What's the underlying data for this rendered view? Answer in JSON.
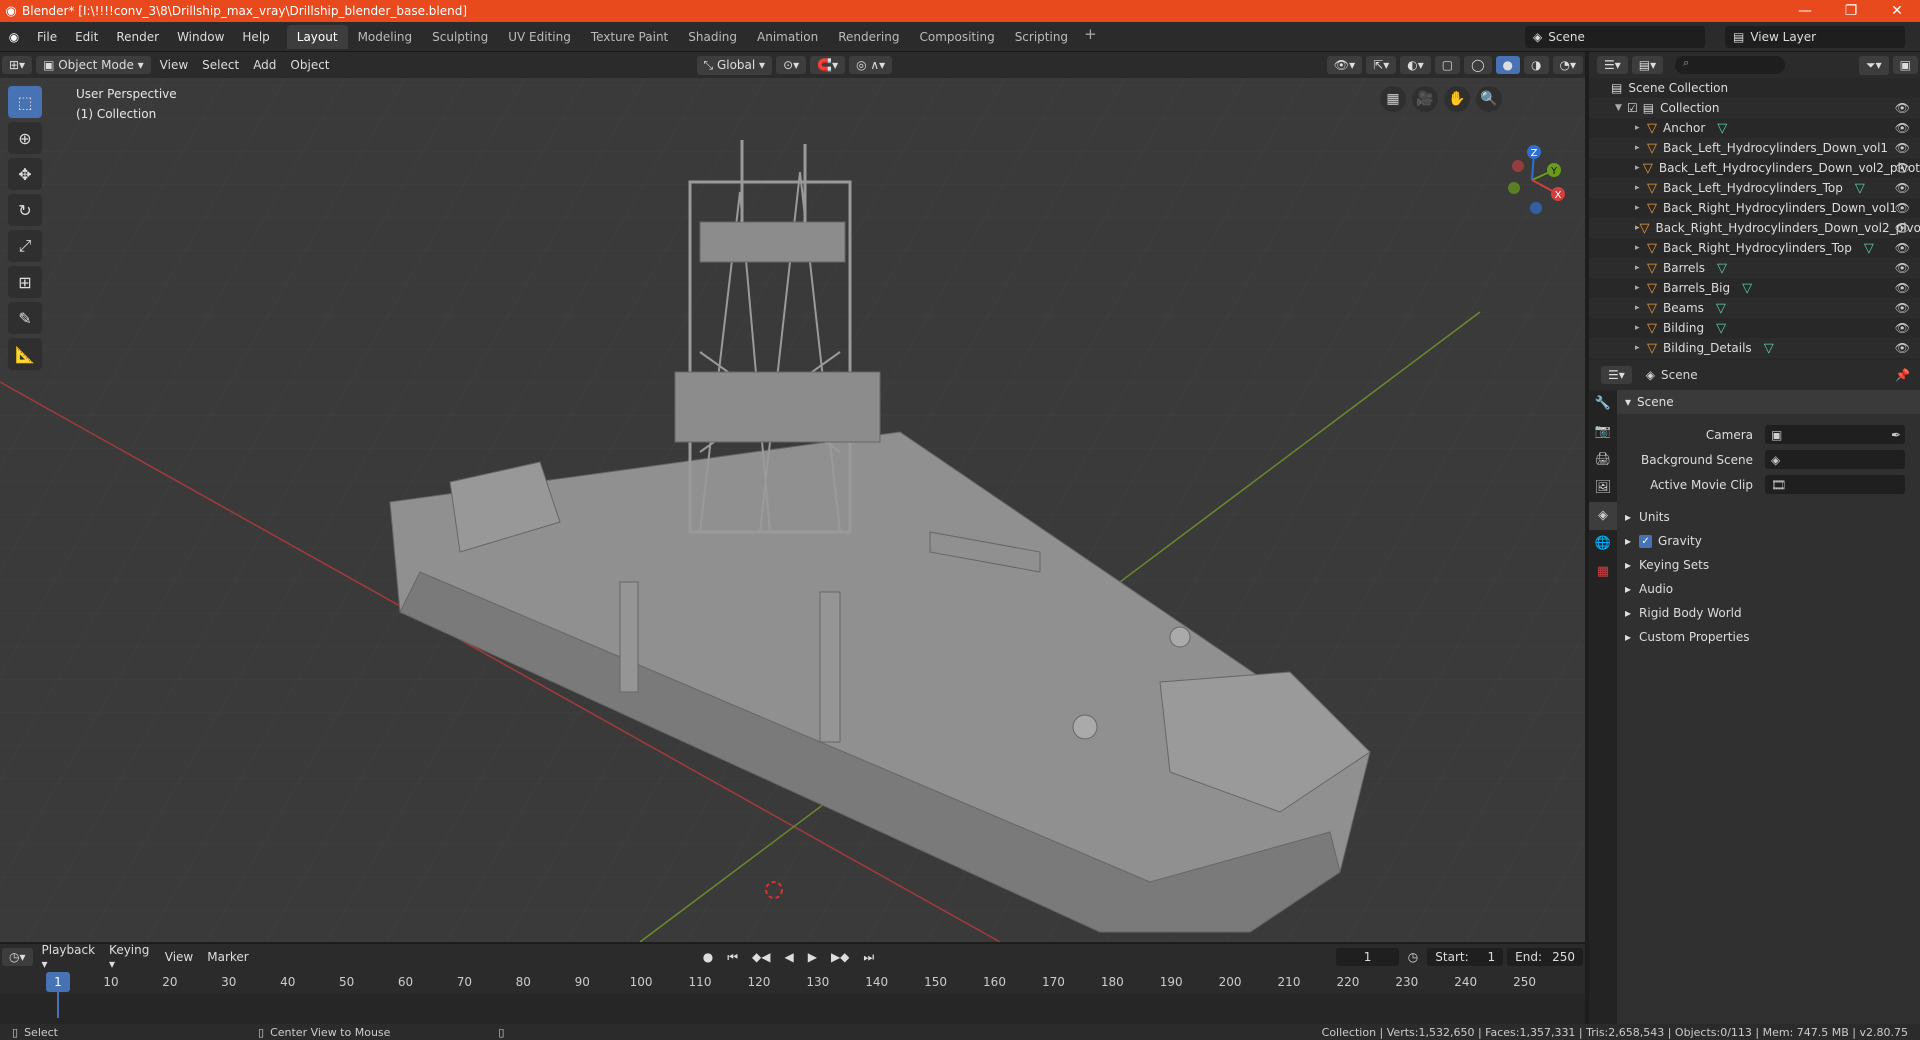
{
  "window": {
    "title": "Blender* [I:\\!!!!conv_3\\8\\Drillship_max_vray\\Drillship_blender_base.blend]",
    "controls": [
      "—",
      "❐",
      "✕"
    ]
  },
  "menu": [
    "File",
    "Edit",
    "Render",
    "Window",
    "Help"
  ],
  "workspaces": [
    "Layout",
    "Modeling",
    "Sculpting",
    "UV Editing",
    "Texture Paint",
    "Shading",
    "Animation",
    "Rendering",
    "Compositing",
    "Scripting"
  ],
  "active_workspace": "Layout",
  "scene_selector": "Scene",
  "view_layer": "View Layer",
  "viewport": {
    "mode": "Object Mode",
    "menus": [
      "View",
      "Select",
      "Add",
      "Object"
    ],
    "transform_orientation": "Global",
    "info_line1": "User Perspective",
    "info_line2": "(1) Collection",
    "gizmo_axes": {
      "z": "Z",
      "y": "Y",
      "x": "X"
    }
  },
  "outliner": {
    "root": "Scene Collection",
    "collection": "Collection",
    "items": [
      {
        "name": "Anchor",
        "mesh": true
      },
      {
        "name": "Back_Left_Hydrocylinders_Down_vol1",
        "mesh": false
      },
      {
        "name": "Back_Left_Hydrocylinders_Down_vol2_pivot",
        "mesh": false
      },
      {
        "name": "Back_Left_Hydrocylinders_Top",
        "mesh": true
      },
      {
        "name": "Back_Right_Hydrocylinders_Down_vol1",
        "mesh": false
      },
      {
        "name": "Back_Right_Hydrocylinders_Down_vol2_pivo",
        "mesh": false
      },
      {
        "name": "Back_Right_Hydrocylinders_Top",
        "mesh": true
      },
      {
        "name": "Barrels",
        "mesh": true
      },
      {
        "name": "Barrels_Big",
        "mesh": true
      },
      {
        "name": "Beams",
        "mesh": true
      },
      {
        "name": "Bilding",
        "mesh": true
      },
      {
        "name": "Bilding_Details",
        "mesh": true
      }
    ]
  },
  "properties": {
    "context": "Scene",
    "panel": "Scene",
    "fields": [
      {
        "label": "Camera",
        "value": ""
      },
      {
        "label": "Background Scene",
        "value": ""
      },
      {
        "label": "Active Movie Clip",
        "value": ""
      }
    ],
    "subpanels": [
      "Units",
      "Gravity",
      "Keying Sets",
      "Audio",
      "Rigid Body World",
      "Custom Properties"
    ],
    "gravity_checked": true
  },
  "timeline": {
    "menus": [
      "Playback",
      "Keying",
      "View",
      "Marker"
    ],
    "current_frame": "1",
    "start_label": "Start:",
    "start": "1",
    "end_label": "End:",
    "end": "250",
    "ticks": [
      "10",
      "20",
      "30",
      "40",
      "50",
      "60",
      "70",
      "80",
      "90",
      "100",
      "110",
      "120",
      "130",
      "140",
      "150",
      "160",
      "170",
      "180",
      "190",
      "200",
      "210",
      "220",
      "230",
      "240",
      "250"
    ]
  },
  "status": {
    "left1": "Select",
    "left2": "Center View to Mouse",
    "right": "Collection | Verts:1,532,650 | Faces:1,357,331 | Tris:2,658,543 | Objects:0/113 | Mem: 747.5 MB | v2.80.75"
  },
  "colors": {
    "titlebar": "#e8491d",
    "accent": "#4772b3",
    "object_icon": "#e89b3c",
    "mesh_icon": "#5cd0a8"
  }
}
